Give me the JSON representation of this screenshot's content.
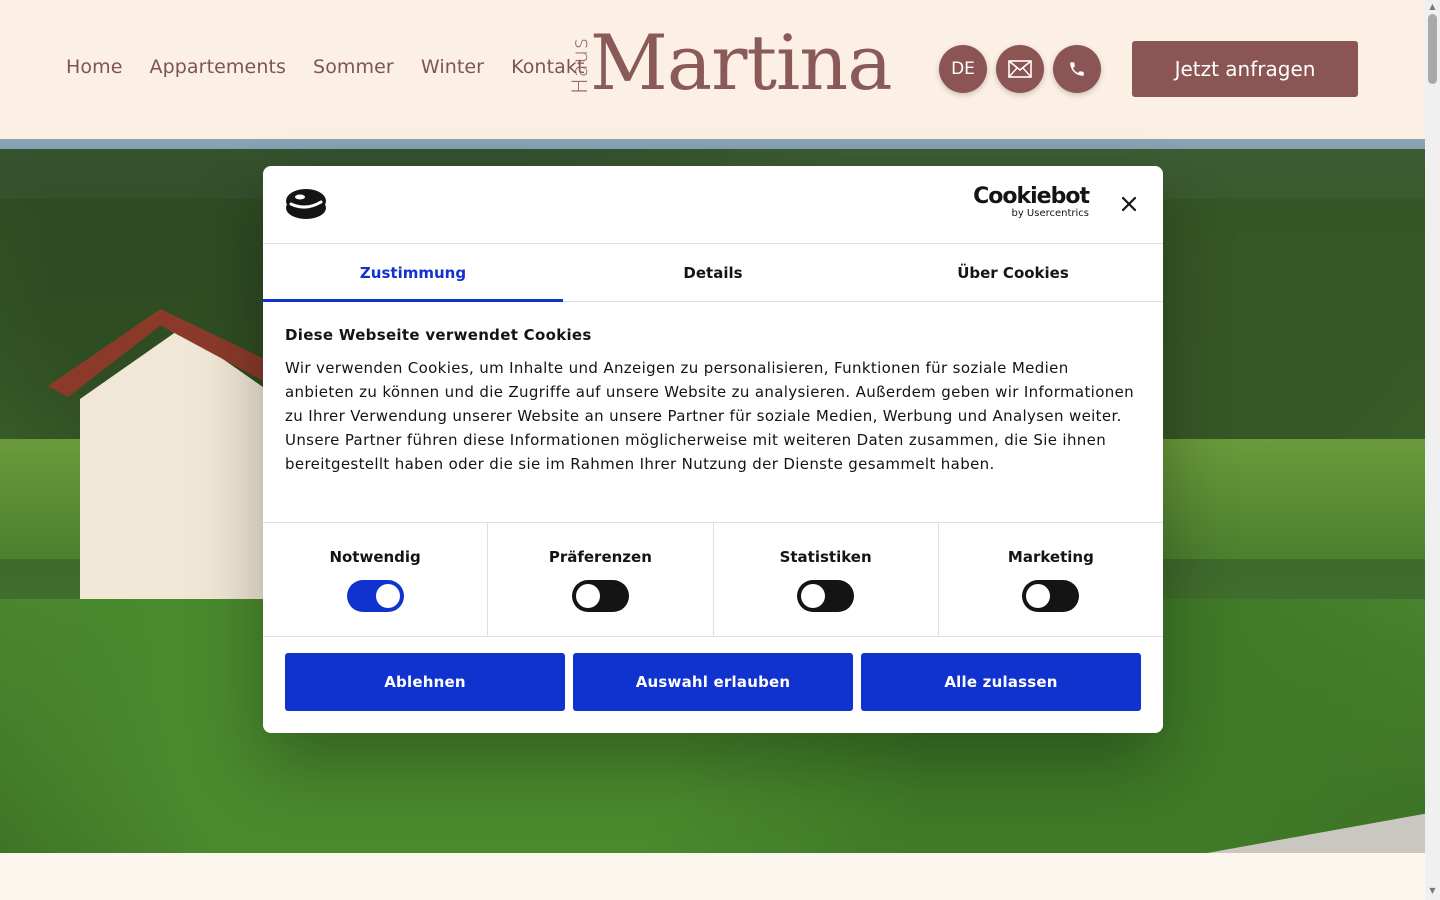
{
  "header": {
    "nav": [
      "Home",
      "Appartements",
      "Sommer",
      "Winter",
      "Kontakt"
    ],
    "logo_small": "Haus",
    "logo_name": "Martina",
    "lang": "DE",
    "cta": "Jetzt anfragen",
    "brand_color": "#8b5553"
  },
  "cookie": {
    "brand": "Cookiebot",
    "brand_sub": "by Usercentrics",
    "tabs": [
      "Zustimmung",
      "Details",
      "Über Cookies"
    ],
    "heading": "Diese Webseite verwendet Cookies",
    "text": "Wir verwenden Cookies, um Inhalte und Anzeigen zu personalisieren, Funktionen für soziale Medien anbieten zu können und die Zugriffe auf unsere Website zu analysieren. Außerdem geben wir Informationen zu Ihrer Verwendung unserer Website an unsere Partner für soziale Medien, Werbung und Analysen weiter. Unsere Partner führen diese Informationen möglicherweise mit weiteren Daten zusammen, die Sie ihnen bereitgestellt haben oder die sie im Rahmen Ihrer Nutzung der Dienste gesammelt haben.",
    "toggles": [
      {
        "label": "Notwendig",
        "on": true
      },
      {
        "label": "Präferenzen",
        "on": false
      },
      {
        "label": "Statistiken",
        "on": false
      },
      {
        "label": "Marketing",
        "on": false
      }
    ],
    "buttons": [
      "Ablehnen",
      "Auswahl erlauben",
      "Alle zulassen"
    ],
    "accent_color": "#1032cf"
  }
}
